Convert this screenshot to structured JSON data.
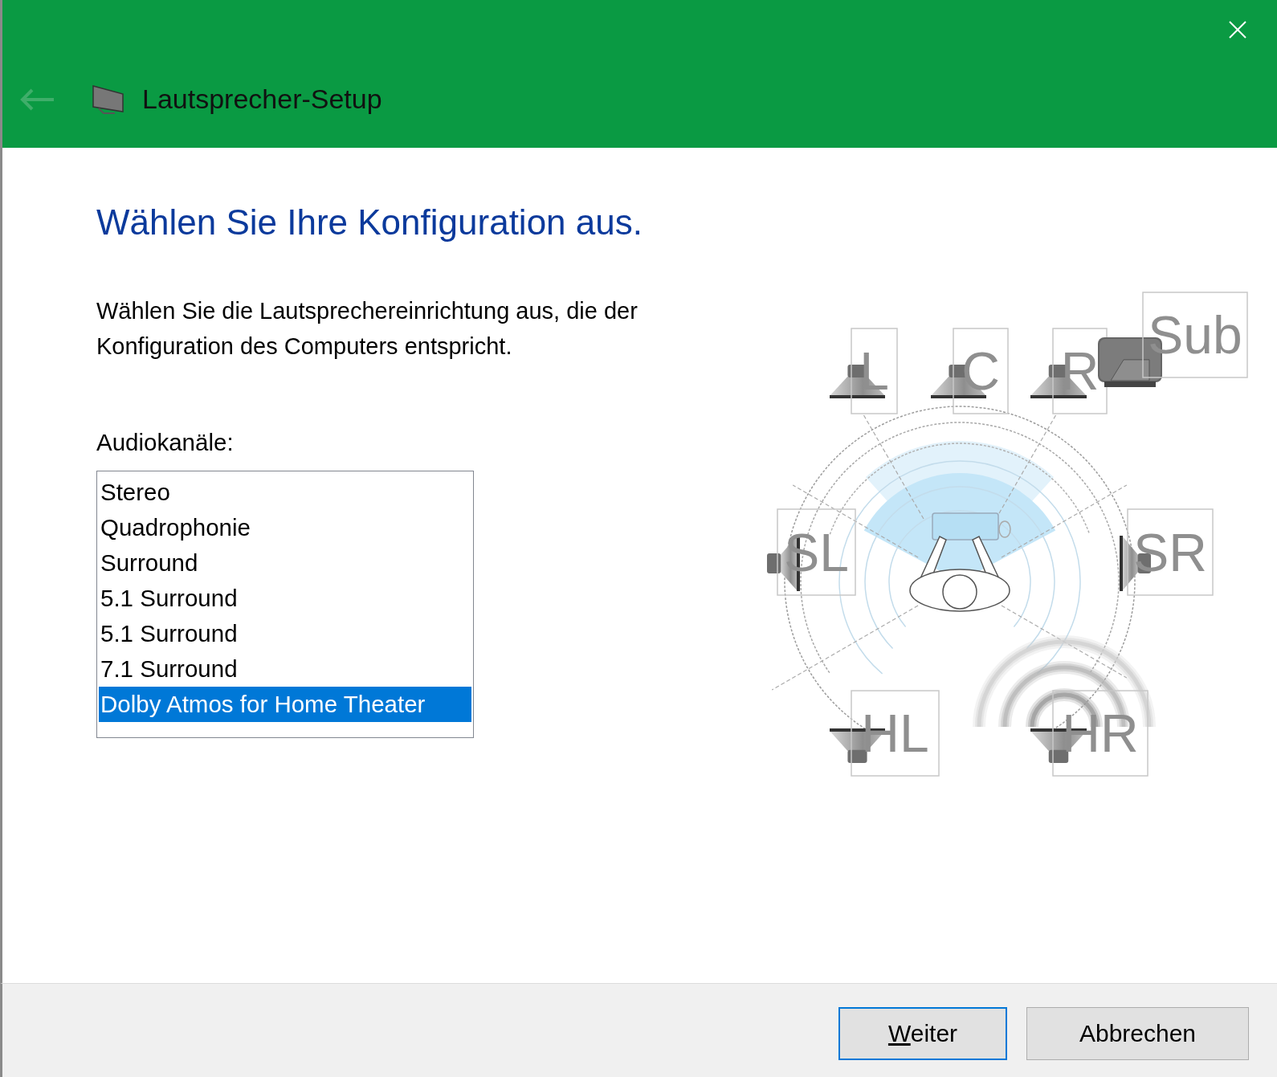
{
  "window": {
    "title": "Lautsprecher-Setup",
    "back_enabled": false
  },
  "heading": "Wählen Sie Ihre Konfiguration aus.",
  "description": "Wählen Sie die Lautsprechereinrichtung aus, die der Konfiguration des Computers entspricht.",
  "channels_label": "Audiokanäle:",
  "channels": [
    {
      "label": "Stereo",
      "selected": false
    },
    {
      "label": "Quadrophonie",
      "selected": false
    },
    {
      "label": "Surround",
      "selected": false
    },
    {
      "label": "5.1 Surround",
      "selected": false
    },
    {
      "label": "5.1 Surround",
      "selected": false
    },
    {
      "label": "7.1 Surround",
      "selected": false
    },
    {
      "label": "Dolby Atmos for Home Theater",
      "selected": true
    }
  ],
  "diagram": {
    "speakers": [
      {
        "label": "L",
        "kind": "front"
      },
      {
        "label": "C",
        "kind": "front"
      },
      {
        "label": "R",
        "kind": "front"
      },
      {
        "label": "Sub",
        "kind": "sub"
      },
      {
        "label": "SL",
        "kind": "side-left"
      },
      {
        "label": "SR",
        "kind": "side-right"
      },
      {
        "label": "HL",
        "kind": "height"
      },
      {
        "label": "HR",
        "kind": "height"
      }
    ]
  },
  "buttons": [
    {
      "label": "Weiter",
      "default": true,
      "underline_first": true
    },
    {
      "label": "Abbrechen",
      "default": false,
      "underline_first": false
    }
  ]
}
